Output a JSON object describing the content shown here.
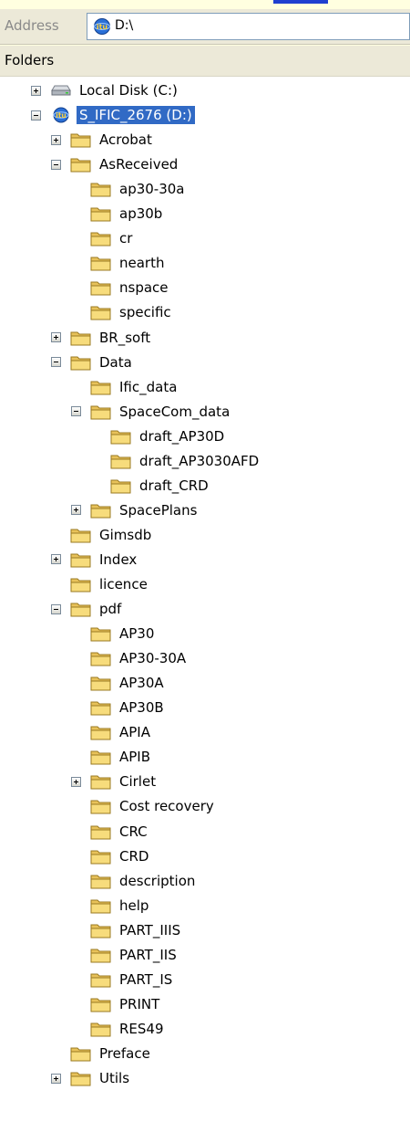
{
  "address": {
    "label": "Address",
    "value": "D:\\",
    "icon": "itu-drive-icon"
  },
  "folders_header": "Folders",
  "tree": [
    {
      "label": "Local Disk (C:)",
      "level": 0,
      "expander": "plus",
      "icon": "hard-drive-icon"
    },
    {
      "label": "S_IFIC_2676 (D:)",
      "level": 0,
      "expander": "minus",
      "icon": "itu-drive-icon",
      "selected": true
    },
    {
      "label": "Acrobat",
      "level": 1,
      "expander": "plus",
      "icon": "folder-icon"
    },
    {
      "label": "AsReceived",
      "level": 1,
      "expander": "minus",
      "icon": "folder-icon"
    },
    {
      "label": "ap30-30a",
      "level": 2,
      "expander": "none",
      "icon": "folder-icon"
    },
    {
      "label": "ap30b",
      "level": 2,
      "expander": "none",
      "icon": "folder-icon"
    },
    {
      "label": "cr",
      "level": 2,
      "expander": "none",
      "icon": "folder-icon"
    },
    {
      "label": "nearth",
      "level": 2,
      "expander": "none",
      "icon": "folder-icon"
    },
    {
      "label": "nspace",
      "level": 2,
      "expander": "none",
      "icon": "folder-icon"
    },
    {
      "label": "specific",
      "level": 2,
      "expander": "none",
      "icon": "folder-icon"
    },
    {
      "label": "BR_soft",
      "level": 1,
      "expander": "plus",
      "icon": "folder-icon"
    },
    {
      "label": "Data",
      "level": 1,
      "expander": "minus",
      "icon": "folder-icon"
    },
    {
      "label": "Ific_data",
      "level": 2,
      "expander": "none",
      "icon": "folder-icon"
    },
    {
      "label": "SpaceCom_data",
      "level": 2,
      "expander": "minus",
      "icon": "folder-icon"
    },
    {
      "label": "draft_AP30D",
      "level": 3,
      "expander": "none",
      "icon": "folder-icon"
    },
    {
      "label": "draft_AP3030AFD",
      "level": 3,
      "expander": "none",
      "icon": "folder-icon"
    },
    {
      "label": "draft_CRD",
      "level": 3,
      "expander": "none",
      "icon": "folder-icon"
    },
    {
      "label": "SpacePlans",
      "level": 2,
      "expander": "plus",
      "icon": "folder-icon"
    },
    {
      "label": "Gimsdb",
      "level": 1,
      "expander": "none",
      "icon": "folder-icon"
    },
    {
      "label": "Index",
      "level": 1,
      "expander": "plus",
      "icon": "folder-icon"
    },
    {
      "label": "licence",
      "level": 1,
      "expander": "none",
      "icon": "folder-icon"
    },
    {
      "label": "pdf",
      "level": 1,
      "expander": "minus",
      "icon": "folder-icon"
    },
    {
      "label": "AP30",
      "level": 2,
      "expander": "none",
      "icon": "folder-icon"
    },
    {
      "label": "AP30-30A",
      "level": 2,
      "expander": "none",
      "icon": "folder-icon"
    },
    {
      "label": "AP30A",
      "level": 2,
      "expander": "none",
      "icon": "folder-icon"
    },
    {
      "label": "AP30B",
      "level": 2,
      "expander": "none",
      "icon": "folder-icon"
    },
    {
      "label": "APIA",
      "level": 2,
      "expander": "none",
      "icon": "folder-icon"
    },
    {
      "label": "APIB",
      "level": 2,
      "expander": "none",
      "icon": "folder-icon"
    },
    {
      "label": "Cirlet",
      "level": 2,
      "expander": "plus",
      "icon": "folder-icon"
    },
    {
      "label": "Cost recovery",
      "level": 2,
      "expander": "none",
      "icon": "folder-icon"
    },
    {
      "label": "CRC",
      "level": 2,
      "expander": "none",
      "icon": "folder-icon"
    },
    {
      "label": "CRD",
      "level": 2,
      "expander": "none",
      "icon": "folder-icon"
    },
    {
      "label": "description",
      "level": 2,
      "expander": "none",
      "icon": "folder-icon"
    },
    {
      "label": "help",
      "level": 2,
      "expander": "none",
      "icon": "folder-icon"
    },
    {
      "label": "PART_IIIS",
      "level": 2,
      "expander": "none",
      "icon": "folder-icon"
    },
    {
      "label": "PART_IIS",
      "level": 2,
      "expander": "none",
      "icon": "folder-icon"
    },
    {
      "label": "PART_IS",
      "level": 2,
      "expander": "none",
      "icon": "folder-icon"
    },
    {
      "label": "PRINT",
      "level": 2,
      "expander": "none",
      "icon": "folder-icon"
    },
    {
      "label": "RES49",
      "level": 2,
      "expander": "none",
      "icon": "folder-icon"
    },
    {
      "label": "Preface",
      "level": 1,
      "expander": "none",
      "icon": "folder-icon"
    },
    {
      "label": "Utils",
      "level": 1,
      "expander": "plus",
      "icon": "folder-icon"
    }
  ]
}
